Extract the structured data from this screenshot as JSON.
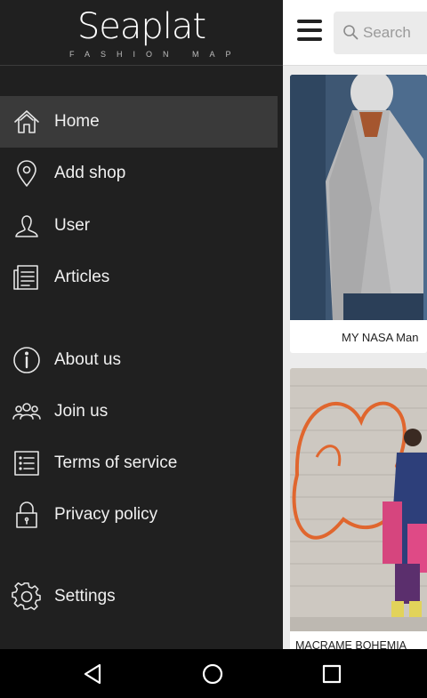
{
  "app": {
    "brand_name": "Seaplat",
    "tagline": "FASHION MAP"
  },
  "search": {
    "placeholder": "Search"
  },
  "drawer": {
    "items": [
      {
        "label": "Home",
        "icon": "home-icon",
        "active": true
      },
      {
        "label": "Add shop",
        "icon": "map-pin-icon",
        "active": false
      },
      {
        "label": "User",
        "icon": "user-icon",
        "active": false
      },
      {
        "label": "Articles",
        "icon": "articles-icon",
        "active": false
      },
      {
        "label": "About us",
        "icon": "info-icon",
        "active": false
      },
      {
        "label": "Join us",
        "icon": "group-icon",
        "active": false
      },
      {
        "label": "Terms of service",
        "icon": "list-icon",
        "active": false
      },
      {
        "label": "Privacy policy",
        "icon": "lock-icon",
        "active": false
      },
      {
        "label": "Settings",
        "icon": "gear-icon",
        "active": false
      }
    ]
  },
  "feed": {
    "cards": [
      {
        "caption": "MY NASA Man"
      },
      {
        "caption": "MACRAME BOHEMIA"
      }
    ]
  },
  "system_nav": {
    "buttons": [
      "back-icon",
      "home-circle-icon",
      "recents-icon"
    ]
  },
  "colors": {
    "drawer_bg": "#202020",
    "active_item_bg": "#3a3a3a",
    "text_light": "#f0f0f0",
    "system_bar": "#000000"
  }
}
